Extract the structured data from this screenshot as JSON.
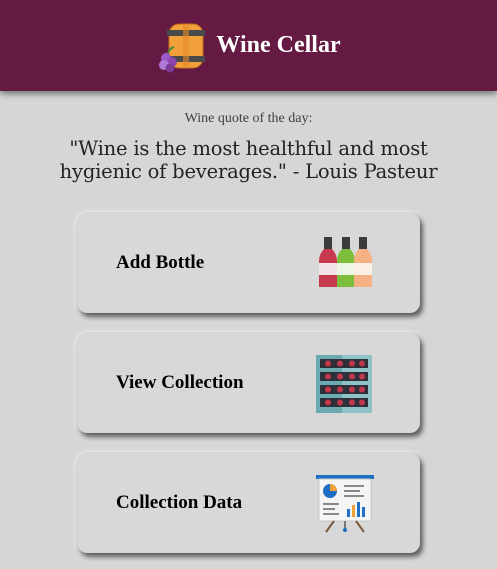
{
  "header": {
    "title": "Wine Cellar",
    "logo_icon": "wine-barrel-grapes-icon",
    "background_color": "#641a42"
  },
  "quote": {
    "label": "Wine quote of the day:",
    "text": "\"Wine is the most healthful and most hygienic of beverages.\" - Louis Pasteur"
  },
  "cards": [
    {
      "label": "Add Bottle",
      "icon": "wine-bottles-icon"
    },
    {
      "label": "View Collection",
      "icon": "wine-rack-icon"
    },
    {
      "label": "Collection Data",
      "icon": "presentation-chart-icon"
    }
  ]
}
